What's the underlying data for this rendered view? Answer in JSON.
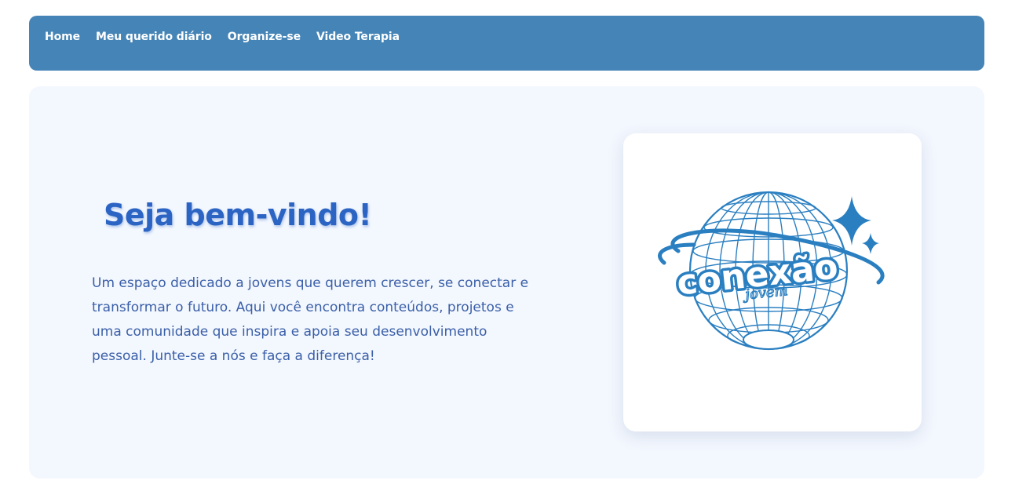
{
  "nav": {
    "items": [
      {
        "label": "Home"
      },
      {
        "label": "Meu querido diário"
      },
      {
        "label": "Organize-se"
      },
      {
        "label": "Video Terapia"
      }
    ]
  },
  "hero": {
    "title": "Seja bem-vindo!",
    "text": "Um espaço dedicado a jovens que querem crescer, se conectar e transformar o futuro. Aqui você encontra conteúdos, projetos e uma comunidade que inspira e apoia seu desenvolvimento pessoal. Junte-se a nós e faça a diferença!"
  },
  "logo": {
    "word_main": "conexão",
    "word_sub": "jovem",
    "icon": "globe-with-sparkles-icon",
    "color": "#2a7fc1"
  },
  "colors": {
    "navbar_bg": "#4584b6",
    "hero_bg": "#f3f7fe",
    "title": "#2c64c4",
    "text": "#3a5fa8"
  }
}
